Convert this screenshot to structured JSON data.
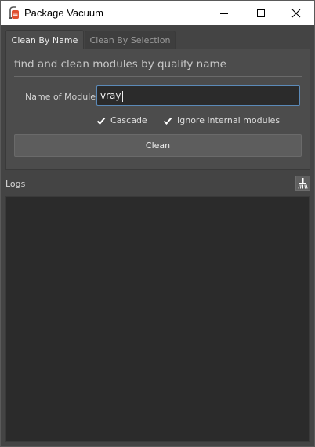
{
  "window": {
    "title": "Package Vacuum",
    "icon": "vacuum-app-icon",
    "controls": [
      "minimize-icon",
      "maximize-icon",
      "close-icon"
    ]
  },
  "tabs": [
    {
      "label": "Clean By Name",
      "active": true
    },
    {
      "label": "Clean By Selection",
      "active": false
    }
  ],
  "clean_by_name": {
    "subtitle": "find and clean modules by qualify name",
    "module_label": "Name of Module",
    "module_value": "vray",
    "cascade_label": "Cascade",
    "cascade_checked": true,
    "ignore_internal_label": "Ignore internal modules",
    "ignore_internal_checked": true,
    "clean_button_label": "Clean"
  },
  "logs": {
    "label": "Logs",
    "clear_icon": "broom-icon",
    "content": ""
  },
  "colors": {
    "accent_input_border": "#5b8ab8",
    "background": "#444444",
    "panel": "#4c4c4c",
    "log_background": "#2b2b2b"
  }
}
